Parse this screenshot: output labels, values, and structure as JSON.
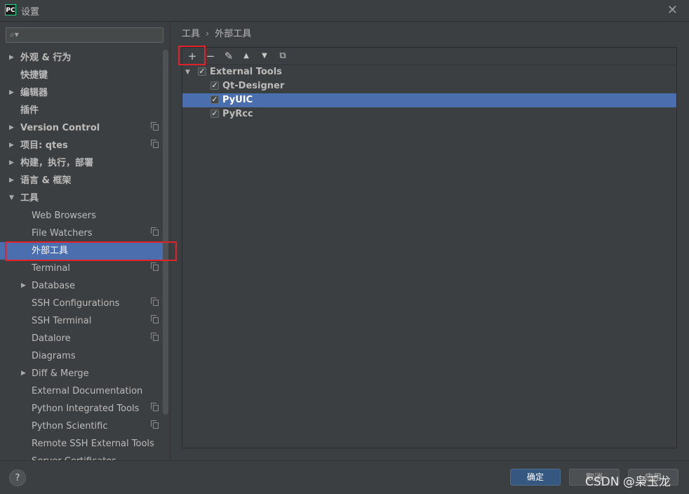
{
  "window": {
    "app_icon": "PC",
    "title": "设置",
    "close_icon": "close-icon"
  },
  "search": {
    "placeholder": "",
    "icon": "search-icon"
  },
  "sidebar": {
    "items": [
      {
        "label": "外观 & 行为",
        "expandable": true,
        "bold": true
      },
      {
        "label": "快捷键",
        "bold": true
      },
      {
        "label": "编辑器",
        "expandable": true,
        "bold": true
      },
      {
        "label": "插件",
        "bold": true
      },
      {
        "label": "Version Control",
        "expandable": true,
        "bold": true,
        "project_icon": true
      },
      {
        "label": "项目: qtes",
        "expandable": true,
        "bold": true,
        "project_icon": true
      },
      {
        "label": "构建，执行，部署",
        "expandable": true,
        "bold": true
      },
      {
        "label": "语言 & 框架",
        "expandable": true,
        "bold": true
      },
      {
        "label": "工具",
        "expanded": true,
        "bold": true
      },
      {
        "label": "Web Browsers"
      },
      {
        "label": "File Watchers",
        "project_icon": true
      },
      {
        "label": "外部工具",
        "selected": true
      },
      {
        "label": "Terminal",
        "project_icon": true
      },
      {
        "label": "Database",
        "expandable": true
      },
      {
        "label": "SSH Configurations",
        "project_icon": true
      },
      {
        "label": "SSH Terminal",
        "project_icon": true
      },
      {
        "label": "Datalore",
        "project_icon": true
      },
      {
        "label": "Diagrams"
      },
      {
        "label": "Diff & Merge",
        "expandable": true
      },
      {
        "label": "External Documentation"
      },
      {
        "label": "Python Integrated Tools",
        "project_icon": true
      },
      {
        "label": "Python Scientific",
        "project_icon": true
      },
      {
        "label": "Remote SSH External Tools"
      },
      {
        "label": "Server Certificates"
      }
    ]
  },
  "breadcrumb": {
    "parent": "工具",
    "separator": "›",
    "current": "外部工具"
  },
  "toolbar": {
    "add": "+",
    "remove": "−",
    "edit": "✎",
    "up": "▲",
    "down": "▼",
    "copy": "⧉"
  },
  "tools": {
    "group": {
      "label": "External Tools",
      "checked": true
    },
    "items": [
      {
        "label": "Qt-Designer",
        "checked": true
      },
      {
        "label": "PyUIC",
        "checked": true,
        "selected": true
      },
      {
        "label": "PyRcc",
        "checked": true
      }
    ]
  },
  "footer": {
    "help": "?",
    "ok": "确定",
    "cancel": "取消",
    "apply": "应用"
  },
  "watermark": "CSDN @枭玉龙",
  "colors": {
    "background": "#3c3f41",
    "selection": "#4b6eaf",
    "highlight_box": "#e0232a",
    "ok_button": "#365880"
  }
}
